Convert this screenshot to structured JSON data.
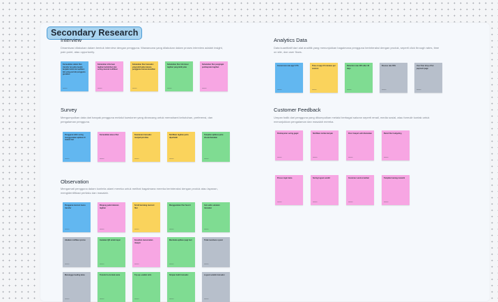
{
  "board": {
    "title": "Secondary Research",
    "sections": {
      "interview": {
        "title": "Interview",
        "desc": "Dinamisasi dilakukan dalam bentuk interview dengan pengguna. Wawancara yang dilakukan dalam proses interview adalah insight, pain point, atau opportunity."
      },
      "analytics": {
        "title": "Analytics Data",
        "desc": "Data kuantitatif dari alat analitik yang menunjukkan bagaimana pengguna berinteraksi dengan produk, seperti click through rates, time on site, dan user flows."
      },
      "survey": {
        "title": "Survey",
        "desc": "Mengumpulkan data dari banyak pengguna melalui kuesioner yang dirancang untuk memahami kebutuhan, preferensi, dan pengalaman pengguna."
      },
      "feedback": {
        "title": "Customer Feedback",
        "desc": "Umpan balik dari pengguna yang dikumpulkan melalui berbagai saluran seperti email, media sosial, atau formulir kontak untuk menunjukkan pengalaman dan masalah mereka."
      },
      "observation": {
        "title": "Observation",
        "desc": "Mengamati pengguna dalam konteks alami mereka untuk melihat bagaimana mereka berinteraksi dengan produk atau layanan, mengidentifikasi perilaku dan masalah."
      }
    }
  },
  "colors": {
    "blue": "#62b7f0",
    "pink": "#f7a6e3",
    "yellow": "#fad35c",
    "gray": "#b7bfcb",
    "green": "#7fdc92"
  },
  "notes": {
    "interview": [
      {
        "color": "blue",
        "text": "Kemudahan dalam fitur transfer tersedia mudah berjalan lebih dari aplikasi lain yang pernah pengguna gunakan.",
        "author": "Hanna"
      },
      {
        "color": "pink",
        "text": "Kebutuhan informasi tagihan berlebihan dan sering muncul notifikasi",
        "author": "Hanna"
      },
      {
        "color": "yellow",
        "text": "Kebutuhan fitur transaksi yang lebih jelas karena pengguna merasa kesulitan",
        "author": "Hanna"
      },
      {
        "color": "green",
        "text": "Kebutuhan fitur informasi tagihan yang lebih jelas",
        "author": "Hanna"
      },
      {
        "color": "pink",
        "text": "Kebutuhan fitur pengingat pembayaran tagihan",
        "author": "Hanna"
      }
    ],
    "analytics": [
      {
        "color": "blue",
        "text": "Conversion rate app 5.7%",
        "author": "Hanna"
      },
      {
        "color": "yellow",
        "text": "Time on app 3.5 minutes per session",
        "author": "Hanna"
      },
      {
        "color": "green",
        "text": "Retention rate 40% after 30 days",
        "author": "Hanna"
      },
      {
        "color": "gray",
        "text": "Bounce rate 35%",
        "author": "Hanna"
      },
      {
        "color": "gray",
        "text": "User flow drop-off at payment page",
        "author": "Hanna"
      }
    ],
    "survey": [
      {
        "color": "blue",
        "text": "Pengguna lebih sering menggunakan aplikasi di malam hari",
        "author": "Hanna"
      },
      {
        "color": "pink",
        "text": "Kemudahan akses fitur",
        "author": "Hanna"
      },
      {
        "color": "yellow",
        "text": "Keamanan transaksi menjadi prioritas",
        "author": "Hanna"
      },
      {
        "color": "yellow",
        "text": "Notifikasi tagihan perlu diperbaiki",
        "author": "Hanna"
      },
      {
        "color": "green",
        "text": "Tampilan aplikasi perlu disederhanakan",
        "author": "Hanna"
      }
    ],
    "feedback": [
      {
        "color": "pink",
        "text": "Pembayaran sering gagal",
        "author": "Hanna"
      },
      {
        "color": "pink",
        "text": "Notifikasi terlalu banyak",
        "author": "Hanna"
      },
      {
        "color": "pink",
        "text": "Fitur riwayat sulit ditemukan",
        "author": "Hanna"
      },
      {
        "color": "pink",
        "text": "Butuh fitur budgeting",
        "author": "Hanna"
      },
      {
        "color": "pink",
        "text": "Proses login lama",
        "author": "Hanna"
      },
      {
        "color": "pink",
        "text": "Sering logout sendiri",
        "author": "Hanna"
      },
      {
        "color": "pink",
        "text": "Customer service lambat",
        "author": "Hanna"
      },
      {
        "color": "pink",
        "text": "Tampilan kurang menarik",
        "author": "Hanna"
      }
    ],
    "observation": [
      {
        "color": "blue",
        "text": "Pengguna mencari menu transfer",
        "author": "Hanna"
      },
      {
        "color": "pink",
        "text": "Bingung pada halaman tagihan",
        "author": "Hanna"
      },
      {
        "color": "yellow",
        "text": "Scroll berulang mencari fitur",
        "author": "Hanna"
      },
      {
        "color": "green",
        "text": "Menggunakan fitur favorit",
        "author": "Hanna"
      },
      {
        "color": "green",
        "text": "Cek saldo sebelum transaksi",
        "author": "Hanna"
      },
      {
        "color": "gray",
        "text": "Abaikan notifikasi promo",
        "author": "Hanna"
      },
      {
        "color": "green",
        "text": "Gunakan QR untuk bayar",
        "author": "Hanna"
      },
      {
        "color": "pink",
        "text": "Kesulitan menemukan riwayat",
        "author": "Hanna"
      },
      {
        "color": "green",
        "text": "Membuka aplikasi pagi hari",
        "author": "Hanna"
      },
      {
        "color": "gray",
        "text": "Tidak membaca syarat",
        "author": "Hanna"
      },
      {
        "color": "gray",
        "text": "Menunggu loading lama",
        "author": "Hanna"
      },
      {
        "color": "green",
        "text": "Transfer ke kontak sama",
        "author": "Hanna"
      },
      {
        "color": "green",
        "text": "Top up e-wallet rutin",
        "author": "Hanna"
      },
      {
        "color": "green",
        "text": "Simpan bukti transaksi",
        "author": "Hanna"
      },
      {
        "color": "gray",
        "text": "Logout setelah transaksi",
        "author": "Hanna"
      }
    ]
  }
}
